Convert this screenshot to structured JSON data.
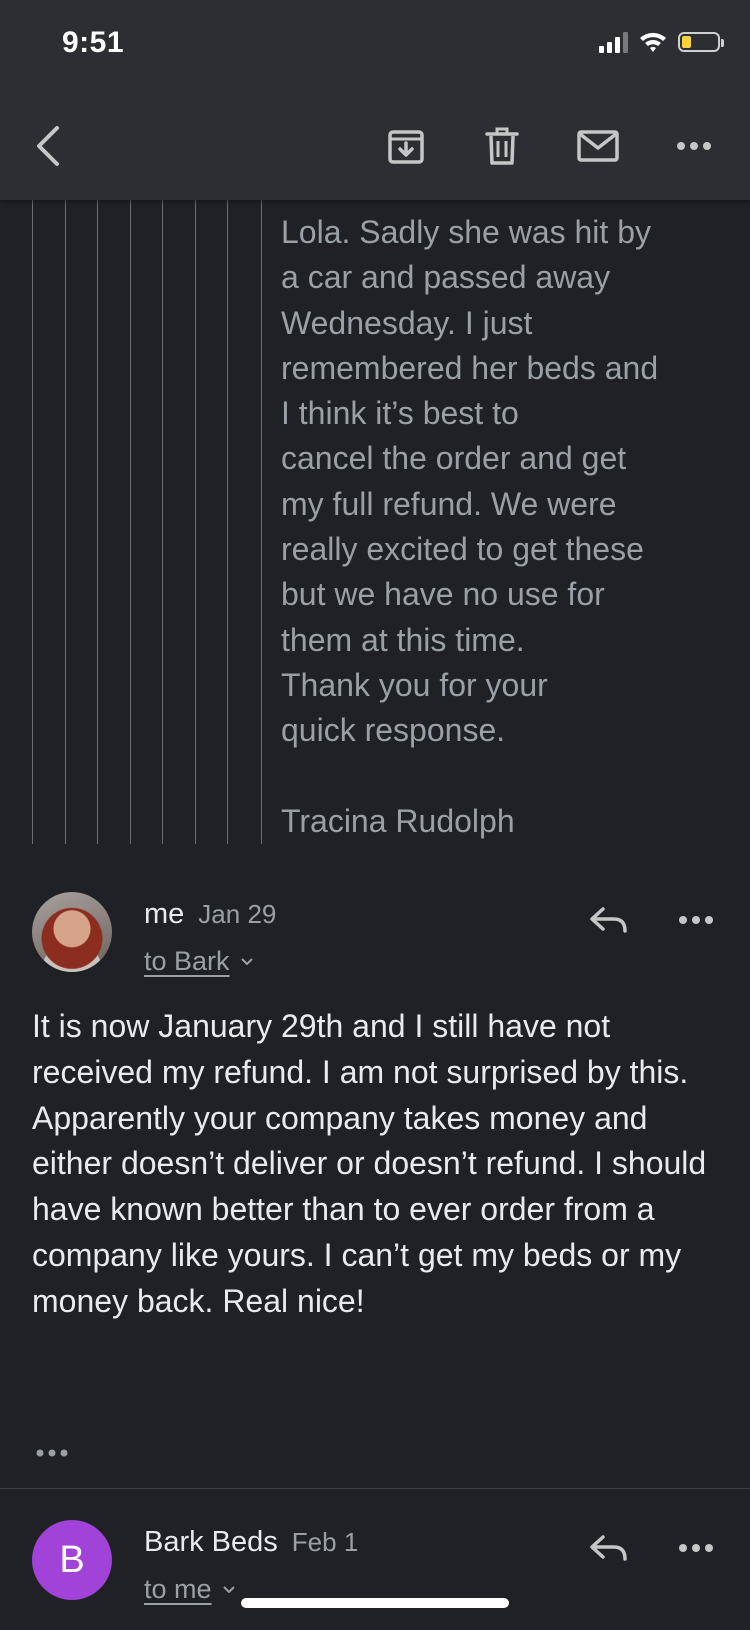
{
  "status_bar": {
    "time": "9:51",
    "icons": [
      "signal-icon",
      "wifi-icon",
      "battery-low-icon"
    ],
    "battery_color": "#f7d23b"
  },
  "toolbar": {
    "icons": [
      "back-arrow-icon",
      "archive-icon",
      "trash-icon",
      "mail-icon",
      "more-horizontal-icon"
    ]
  },
  "quoted_message": {
    "text": "Lola. Sadly she was hit by\na car and passed away\nWednesday. I just\nremembered her beds and\nI think it’s best to\ncancel the order and get\nmy full refund. We were\nreally excited to get these\nbut we have no use for\nthem at this time.\nThank you for your\nquick response.\n\nTracina Rudolph"
  },
  "messages": [
    {
      "sender": "me",
      "date": "Jan 29",
      "recipient": "to Bark",
      "body": "It is now January 29th and I still have not received my refund. I am not surprised by this. Apparently your company takes money and either doesn’t deliver or doesn’t refund. I should have known better than to ever order from a company like yours. I can’t get my beds or my money back. Real nice!",
      "avatar": "profile-photo"
    },
    {
      "sender": "Bark Beds",
      "date": "Feb 1",
      "recipient": "to me",
      "avatar_letter": "B",
      "avatar_color": "#a142d8"
    }
  ],
  "colors": {
    "background": "#202124",
    "toolbar": "#2d2e31",
    "quoted_text": "#9aa0a6",
    "body_text": "#e8eaed"
  }
}
